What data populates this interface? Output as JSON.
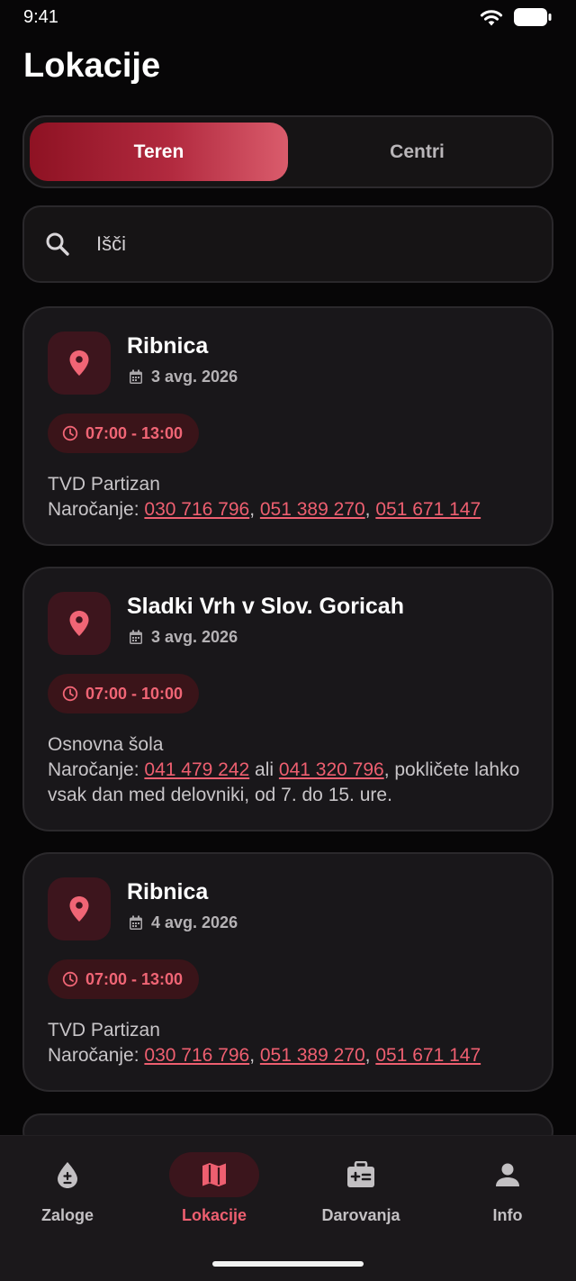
{
  "status_bar": {
    "time": "9:41"
  },
  "page": {
    "title": "Lokacije"
  },
  "tabs": [
    {
      "label": "Teren",
      "active": true
    },
    {
      "label": "Centri",
      "active": false
    }
  ],
  "search": {
    "placeholder": "Išči",
    "value": ""
  },
  "colors": {
    "accent": "#ee5f70",
    "accent_dark": "#8e1223",
    "background": "#070607",
    "card": "#19171a"
  },
  "cards": [
    {
      "name": "Ribnica",
      "date": "3 avg. 2026",
      "time": "07:00 - 13:00",
      "venue": "TVD Partizan",
      "order_label": "Naročanje:",
      "phones": [
        "030 716 796",
        "051 389 270",
        "051 671 147"
      ],
      "sep": ", "
    },
    {
      "name": "Sladki Vrh v Slov. Goricah",
      "date": "3 avg. 2026",
      "time": "07:00 - 10:00",
      "venue": "Osnovna šola",
      "order_label": "Naročanje:",
      "phones": [
        "041 479 242",
        "041 320 796"
      ],
      "sep": " ali ",
      "note": ", pokličete lahko vsak dan med delovniki, od 7. do 15. ure."
    },
    {
      "name": "Ribnica",
      "date": "4 avg. 2026",
      "time": "07:00 - 13:00",
      "venue": "TVD Partizan",
      "order_label": "Naročanje:",
      "phones": [
        "030 716 796",
        "051 389 270",
        "051 671 147"
      ],
      "sep": ", "
    }
  ],
  "nav": [
    {
      "label": "Zaloge",
      "icon": "blood-drop-icon",
      "active": false
    },
    {
      "label": "Lokacije",
      "icon": "map-icon",
      "active": true
    },
    {
      "label": "Darovanja",
      "icon": "medical-kit-icon",
      "active": false
    },
    {
      "label": "Info",
      "icon": "person-icon",
      "active": false
    }
  ]
}
